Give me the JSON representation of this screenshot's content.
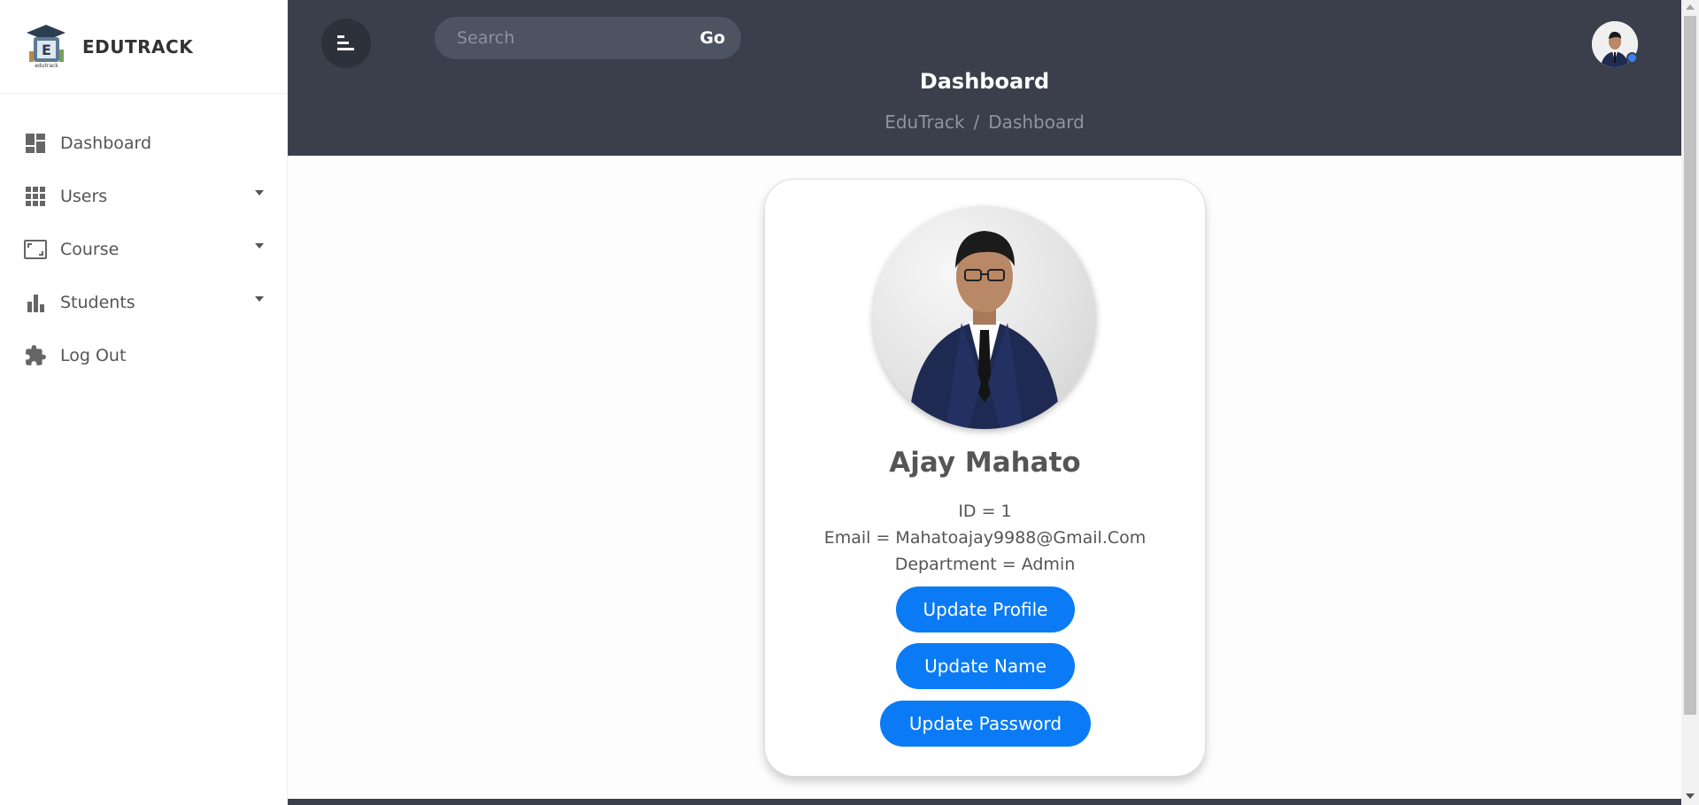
{
  "brand": {
    "title": "EDUTRACK",
    "logo_text": "edutrack"
  },
  "sidebar": {
    "items": [
      {
        "label": "Dashboard",
        "icon": "dashboard-icon",
        "has_dropdown": false
      },
      {
        "label": "Users",
        "icon": "grid-icon",
        "has_dropdown": true
      },
      {
        "label": "Course",
        "icon": "crop-frame-icon",
        "has_dropdown": true
      },
      {
        "label": "Students",
        "icon": "bar-chart-icon",
        "has_dropdown": true
      },
      {
        "label": "Log Out",
        "icon": "puzzle-icon",
        "has_dropdown": false
      }
    ]
  },
  "header": {
    "search": {
      "placeholder": "Search",
      "value": "",
      "button_label": "Go"
    },
    "title": "Dashboard",
    "breadcrumb": [
      "EduTrack",
      "Dashboard"
    ],
    "breadcrumb_separator": "/"
  },
  "profile": {
    "name": "Ajay Mahato",
    "id_line": "ID = 1",
    "email_line": "Email = Mahatoajay9988@Gmail.Com",
    "department_line": "Department = Admin",
    "buttons": {
      "update_profile": "Update Profile",
      "update_name": "Update Name",
      "update_password": "Update Password"
    }
  },
  "colors": {
    "header_bg": "#3a3f4b",
    "primary_button": "#0a7bf5",
    "status_online": "#3b82f6"
  }
}
